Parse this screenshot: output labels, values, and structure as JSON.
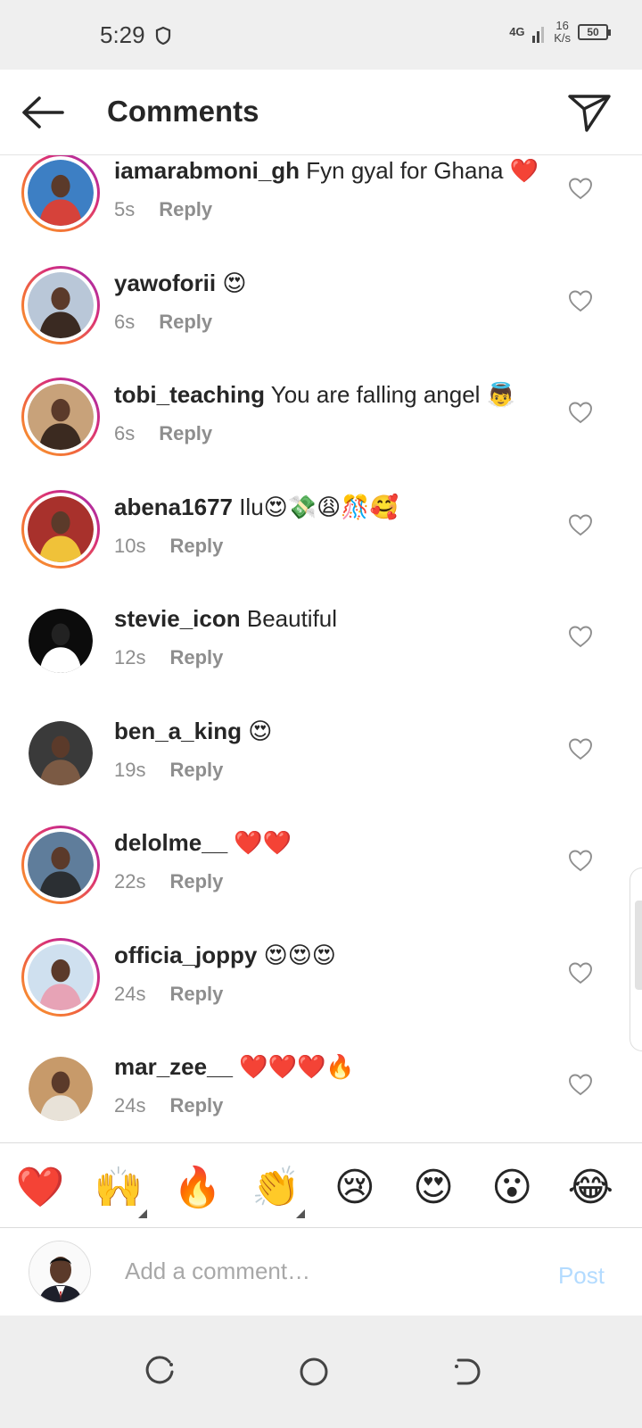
{
  "status_bar": {
    "time": "5:29",
    "network": "4G",
    "speed_value": "16",
    "speed_unit": "K/s",
    "battery": "50"
  },
  "header": {
    "title": "Comments"
  },
  "comments": [
    {
      "username": "iamarabmoni_gh",
      "text": " Fyn gyal for Ghana ❤️",
      "time": "5s",
      "reply": "Reply",
      "story_ring": true
    },
    {
      "username": "yawoforii",
      "text": " 😍",
      "time": "6s",
      "reply": "Reply",
      "story_ring": true
    },
    {
      "username": "tobi_teaching",
      "text": " You are falling angel 👼",
      "time": "6s",
      "reply": "Reply",
      "story_ring": true
    },
    {
      "username": "abena1677",
      "text": " Ilu😍💸😩🎊🥰",
      "time": "10s",
      "reply": "Reply",
      "story_ring": true
    },
    {
      "username": "stevie_icon",
      "text": " Beautiful",
      "time": "12s",
      "reply": "Reply",
      "story_ring": false
    },
    {
      "username": "ben_a_king",
      "text": " 😍",
      "time": "19s",
      "reply": "Reply",
      "story_ring": false
    },
    {
      "username": "delolme__",
      "text": " ❤️❤️",
      "time": "22s",
      "reply": "Reply",
      "story_ring": true
    },
    {
      "username": "officia_joppy",
      "text": " 😍😍😍",
      "time": "24s",
      "reply": "Reply",
      "story_ring": true
    },
    {
      "username": "mar_zee__",
      "text": " ❤️❤️❤️🔥",
      "time": "24s",
      "reply": "Reply",
      "story_ring": false
    }
  ],
  "quick_reactions": [
    "❤️",
    "🙌",
    "🔥",
    "👏",
    "😢",
    "😍",
    "😮",
    "😂"
  ],
  "compose": {
    "placeholder": "Add a comment…",
    "post_label": "Post"
  },
  "colors": {
    "accent": "#0095f6",
    "post_disabled": "#b3dbff",
    "meta_grey": "#8e8e8e",
    "story_ring_start": "#f9a12e",
    "story_ring_end": "#9b2cb5"
  }
}
